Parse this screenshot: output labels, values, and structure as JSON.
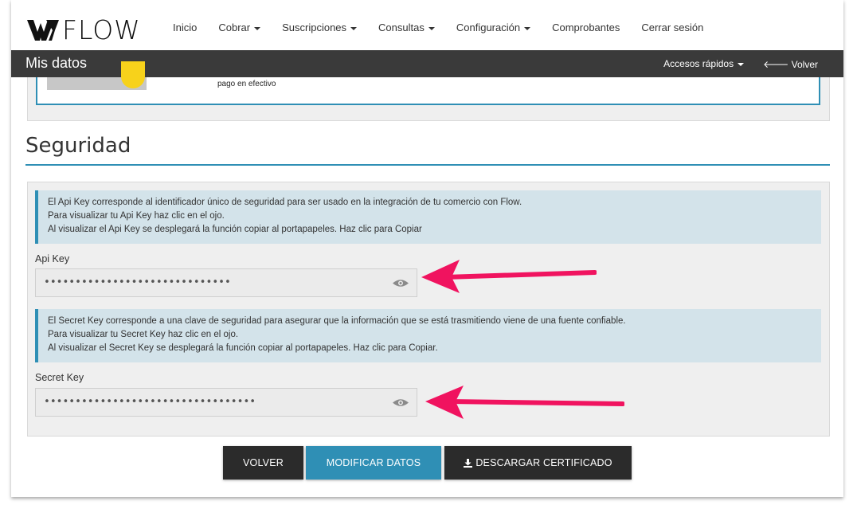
{
  "nav": {
    "logo_text": "FLOW",
    "items": [
      {
        "label": "Inicio",
        "dropdown": false
      },
      {
        "label": "Cobrar",
        "dropdown": true
      },
      {
        "label": "Suscripciones",
        "dropdown": true
      },
      {
        "label": "Consultas",
        "dropdown": true
      },
      {
        "label": "Configuración",
        "dropdown": true
      },
      {
        "label": "Comprobantes",
        "dropdown": false
      },
      {
        "label": "Cerrar sesión",
        "dropdown": false
      }
    ]
  },
  "bar": {
    "title": "Mis datos",
    "quick_access": "Accesos rápidos",
    "back": "Volver"
  },
  "card": {
    "text": "pago en efectivo"
  },
  "security": {
    "title": "Seguridad",
    "api_info": [
      "El Api Key corresponde al identificador único de seguridad para ser usado en la integración de tu comercio con Flow.",
      "Para visualizar tu Api Key haz clic en el ojo.",
      "Al visualizar el Api Key se desplegará la función copiar al portapapeles. Haz clic para Copiar"
    ],
    "api_label": "Api Key",
    "api_value": "••••••••••••••••••••••••••••••",
    "secret_info": [
      "El Secret Key corresponde a una clave de seguridad para asegurar que la información que se está trasmitiendo viene de una fuente confiable.",
      "Para visualizar tu Secret Key haz clic en el ojo.",
      "Al visualizar el Secret Key se desplegará la función copiar al portapapeles. Haz clic para Copiar."
    ],
    "secret_label": "Secret Key",
    "secret_value": "••••••••••••••••••••••••••••••••••"
  },
  "buttons": {
    "volver": "VOLVER",
    "modificar": "MODIFICAR DATOS",
    "descargar": "DESCARGAR CERTIFICADO"
  },
  "colors": {
    "accent": "#2f8fb5",
    "dark": "#3a3a3a",
    "arrow": "#f0135f"
  }
}
